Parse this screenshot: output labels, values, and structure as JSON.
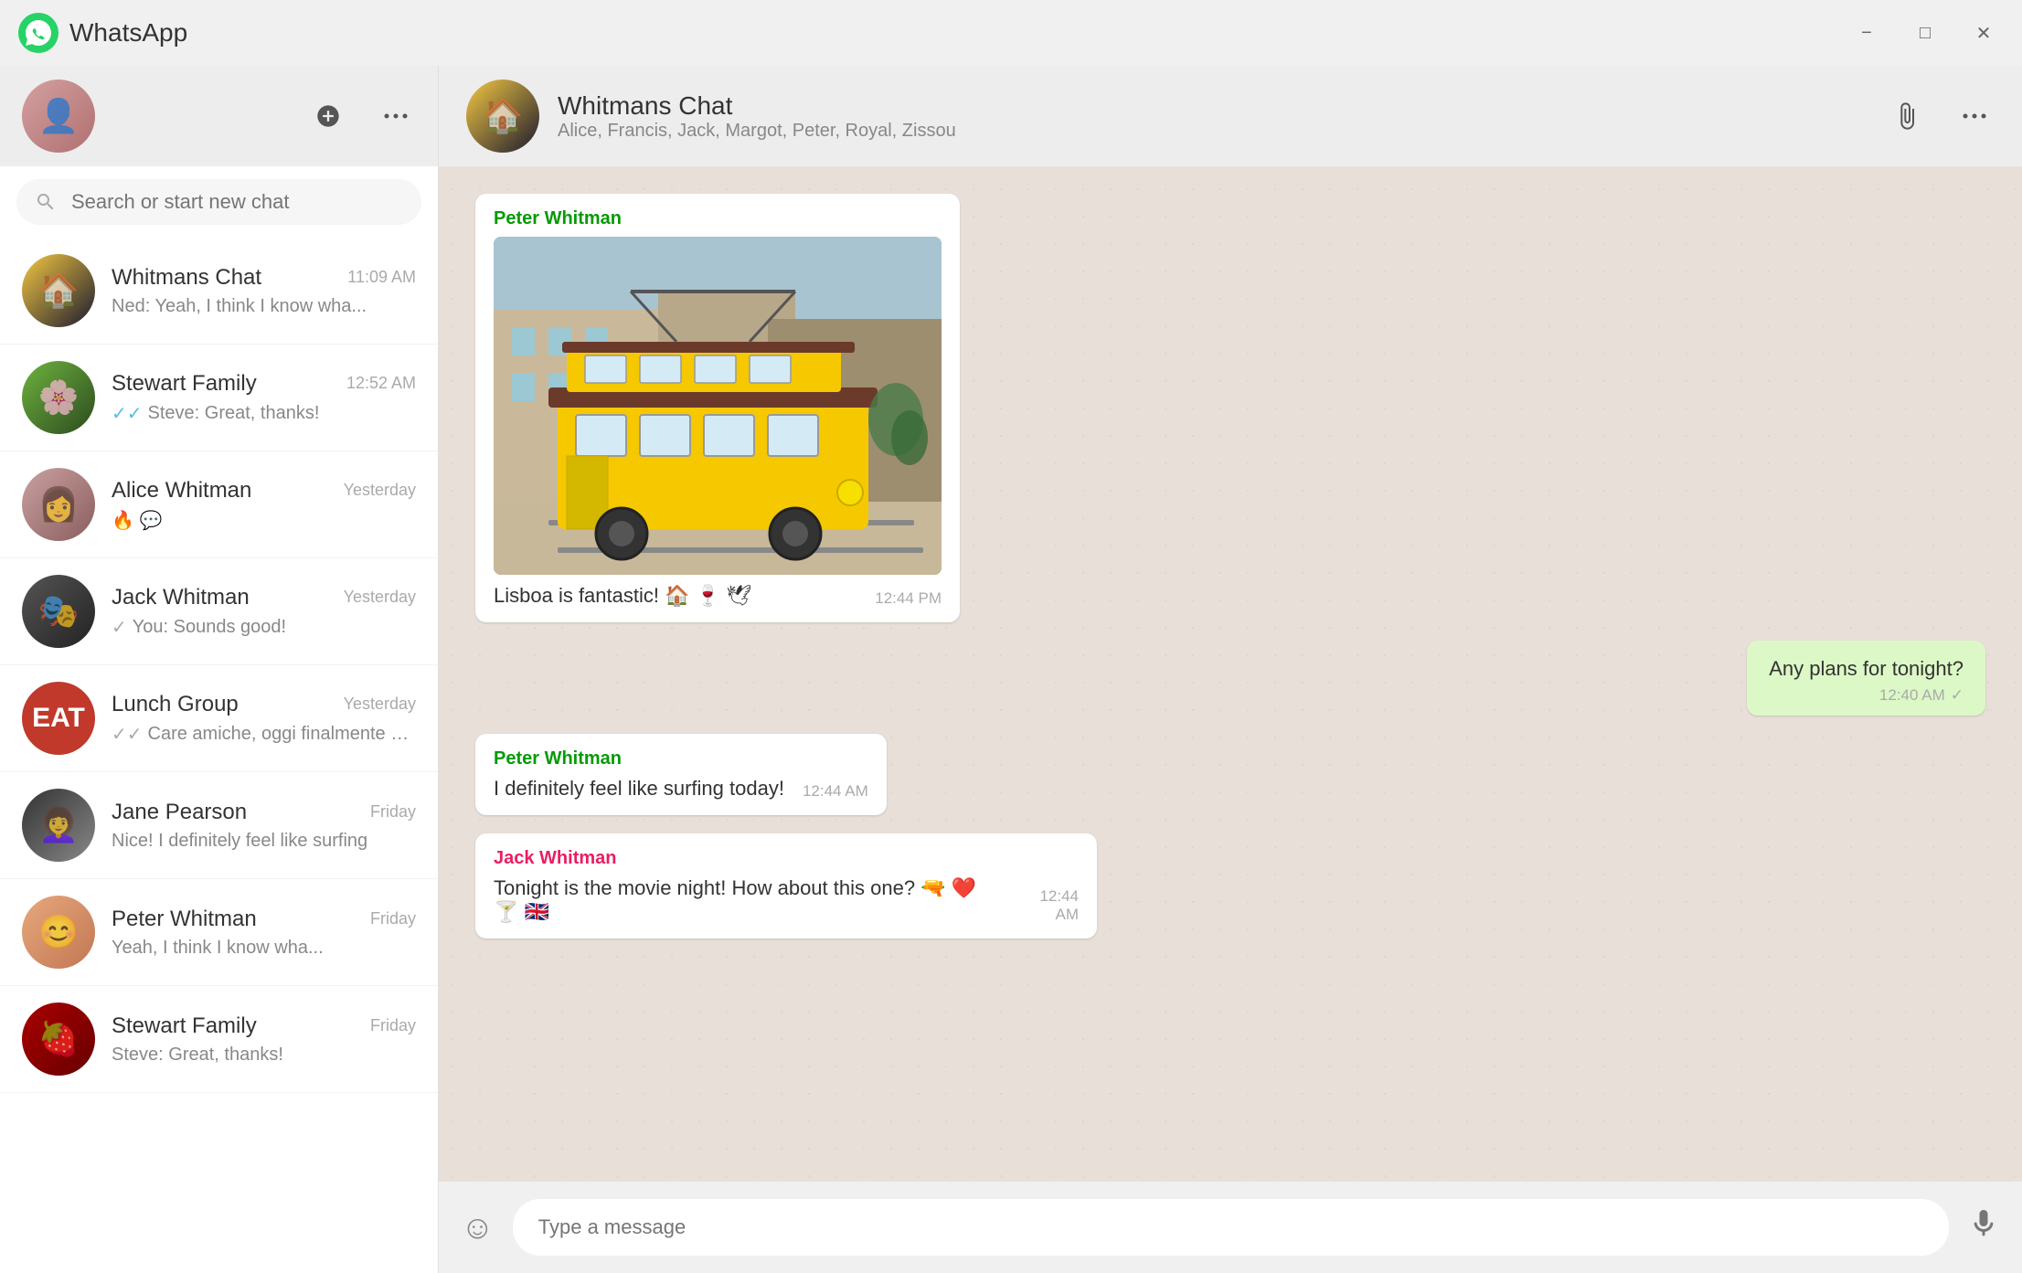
{
  "titleBar": {
    "title": "WhatsApp",
    "minimize": "−",
    "maximize": "□",
    "close": "✕"
  },
  "sidebar": {
    "searchPlaceholder": "Search or start new chat",
    "chats": [
      {
        "id": "whitmans",
        "name": "Whitmans Chat",
        "time": "11:09 AM",
        "preview": "Ned: Yeah, I think I know wha...",
        "checkType": "none",
        "avatarClass": "av-whitmans"
      },
      {
        "id": "stewart-family",
        "name": "Stewart Family",
        "time": "12:52 AM",
        "preview": "Steve: Great, thanks!",
        "checkType": "double-blue",
        "avatarClass": "av-stewart"
      },
      {
        "id": "alice",
        "name": "Alice Whitman",
        "time": "Yesterday",
        "preview": "🔥 💬",
        "checkType": "none",
        "avatarClass": "av-alice"
      },
      {
        "id": "jack",
        "name": "Jack Whitman",
        "time": "Yesterday",
        "preview": "You: Sounds good!",
        "checkType": "single",
        "avatarClass": "av-jack"
      },
      {
        "id": "lunch",
        "name": "Lunch Group",
        "time": "Yesterday",
        "preview": "Care amiche, oggi finalmente posso",
        "checkType": "double",
        "avatarClass": "av-lunch",
        "lunchText": "EAT"
      },
      {
        "id": "jane",
        "name": "Jane Pearson",
        "time": "Friday",
        "preview": "Nice! I definitely feel like surfing",
        "checkType": "none",
        "avatarClass": "av-jane"
      },
      {
        "id": "peter",
        "name": "Peter Whitman",
        "time": "Friday",
        "preview": "Yeah, I think I know wha...",
        "checkType": "none",
        "avatarClass": "av-peter"
      },
      {
        "id": "stewart-family2",
        "name": "Stewart Family",
        "time": "Friday",
        "preview": "Steve: Great, thanks!",
        "checkType": "none",
        "avatarClass": "av-stewart2"
      }
    ]
  },
  "chatHeader": {
    "name": "Whitmans Chat",
    "members": "Alice, Francis, Jack, Margot, Peter, Royal, Zissou"
  },
  "messages": [
    {
      "id": "msg1",
      "type": "incoming",
      "sender": "Peter Whitman",
      "senderClass": "peter",
      "hasImage": true,
      "text": "Lisboa is fantastic! 🏠 🍷 🕊",
      "time": "12:44 PM"
    },
    {
      "id": "msg-out1",
      "type": "outgoing",
      "text": "Any plans for tonight?",
      "time": "12:40 AM",
      "checkMark": "✓"
    },
    {
      "id": "msg2",
      "type": "incoming",
      "sender": "Peter Whitman",
      "senderClass": "peter",
      "hasImage": false,
      "text": "I definitely feel like surfing today!",
      "time": "12:44 AM"
    },
    {
      "id": "msg3",
      "type": "incoming",
      "sender": "Jack Whitman",
      "senderClass": "jack",
      "hasImage": false,
      "text": "Tonight is the movie night! How about this one? 🔫 ❤️ 🍸 🇬🇧",
      "time": "12:44 AM"
    }
  ],
  "inputBar": {
    "placeholder": "Type a message",
    "emojiIcon": "☺",
    "micIcon": "🎙"
  }
}
